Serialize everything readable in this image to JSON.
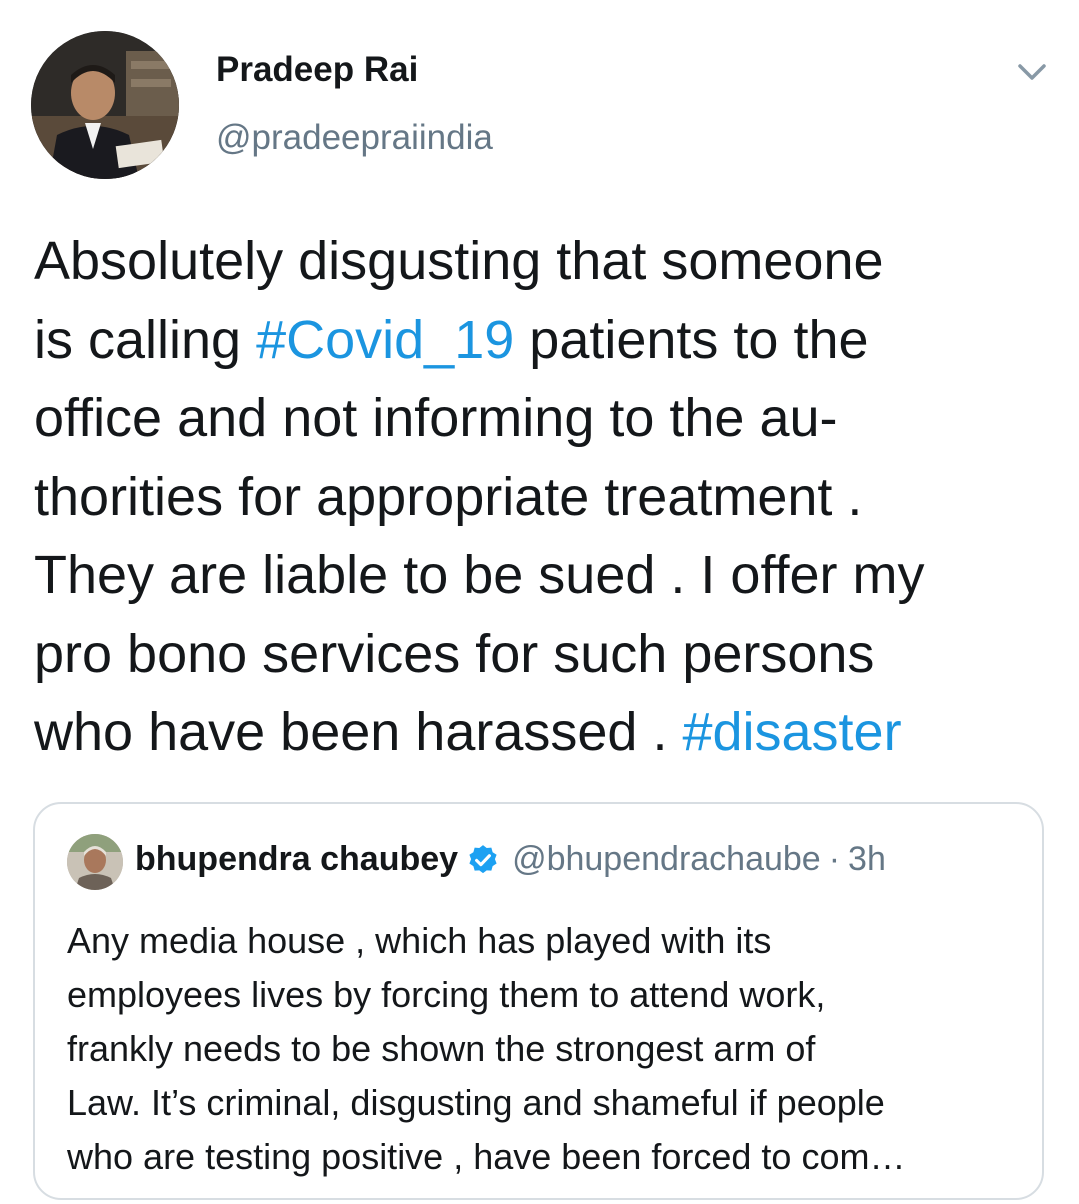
{
  "author": {
    "display_name": "Pradeep Rai",
    "handle": "@pradeepraiindia"
  },
  "tweet": {
    "lines": [
      {
        "text": "Absolutely disgusting that someone"
      },
      {
        "pre": "is calling ",
        "tag": "#Covid_19",
        "post": " patients to the"
      },
      {
        "text": "office and not informing to the au-"
      },
      {
        "text": "thorities for appropriate treatment ."
      },
      {
        "text": "They are liable to be sued . I offer my"
      },
      {
        "text": "pro bono services for such persons"
      },
      {
        "pre": "who have been harassed . ",
        "tag": "#disaster",
        "post": ""
      }
    ]
  },
  "quoted_tweet": {
    "display_name": "bhupendra chaubey",
    "handle": "@bhupendrachaube",
    "separator": "·",
    "time": "3h",
    "lines": [
      "Any media house , which has played with its",
      "employees lives by forcing them to attend work,",
      "frankly needs to be shown the strongest arm of",
      "Law. It’s criminal, disgusting and shameful if people",
      "who are testing positive , have been forced to com…"
    ]
  },
  "colors": {
    "link": "#1b95e0",
    "text": "#14171a",
    "secondary": "#657786",
    "border": "#d7dde2",
    "verified": "#1da1f2"
  },
  "icons": {
    "menu": "chevron-down-icon",
    "verified": "verified-badge-icon"
  }
}
